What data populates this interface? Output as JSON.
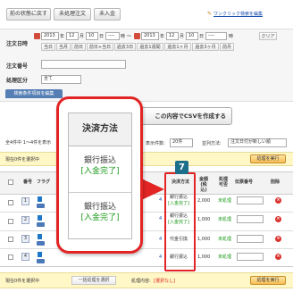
{
  "toolbar": {
    "back_label": "前の状態に戻す",
    "unprocessed_label": "未処理注文",
    "received_label": "未入金",
    "oneclick_label": "ワンクリック検索を編集"
  },
  "search": {
    "order_date_label": "注文日時",
    "year_from": "2013",
    "year_unit": "年",
    "month_from": "12",
    "month_unit": "月",
    "day_from": "10",
    "day_unit": "日",
    "hour_from": "----",
    "hour_unit": "時",
    "to_sep": "〜",
    "year_to": "2013",
    "month_to": "12",
    "day_to": "10",
    "hour_to": "----",
    "clear_label": "クリア",
    "quick_today": "当日",
    "quick_month": "当月",
    "quick_prev": "前日",
    "quick_prev_today": "前日+当日",
    "quick_3days": "過去3日",
    "quick_1week": "過去1週間",
    "quick_1month": "過去1ヶ月",
    "quick_3months": "過去3ヶ月",
    "quick_next": "前月",
    "order_no_label": "注文番号",
    "status_label": "処理区分",
    "status_value": "全て",
    "edit_conditions_label": "検索条件項目を編集"
  },
  "csv": {
    "create_label": "この内容でCSVを作成する"
  },
  "list": {
    "count_text": "全4件中 1〜4件を表示",
    "per_page_label": "表示件数:",
    "per_page_value": "20件",
    "sort_label": "並列方法:",
    "sort_value": "注文日付が新しい順"
  },
  "bulk_top": {
    "selected_text": "現在0件を選択中",
    "execute_label": "処理を実行"
  },
  "table": {
    "headers": {
      "check": "",
      "number": "番号",
      "flag": "フラグ",
      "payment": "決済方法",
      "amount": "金額(税込)",
      "process": "処理可否",
      "tracking": "伝票番号",
      "delete": "削除"
    },
    "rows": [
      {
        "number": "1",
        "pay_line1": "銀行振込",
        "pay_line2": "[入金完了]",
        "amount": "2,000",
        "process": "未処理"
      },
      {
        "number": "2",
        "pay_line1": "銀行振込",
        "pay_line2": "[入金完了]",
        "amount": "1,000",
        "process": "未処理"
      },
      {
        "number": "3",
        "pay_line1": "代金引換",
        "pay_line2": "",
        "amount": "1,000",
        "process": "未処理"
      },
      {
        "number": "4",
        "pay_line1": "銀行振込",
        "pay_line2": "",
        "amount": "1,000",
        "process": "未処理"
      }
    ],
    "partial_numbers": [
      "4",
      "4",
      "4",
      "4"
    ]
  },
  "callout": {
    "header": "決済方法",
    "rows": [
      {
        "line1": "銀行振込",
        "line2": "[入金完了]"
      },
      {
        "line1": "銀行振込",
        "line2": "[入金完了]"
      }
    ]
  },
  "step_badge": "7",
  "bulk_bottom": {
    "selected_text": "現在0件を選択中",
    "select_all_label": "一括処理を選択",
    "process_text": "処理内容:",
    "process_value": "[選択なし]",
    "execute_label": "処理を実行"
  },
  "colors": {
    "accent_red": "#e22424",
    "badge_teal": "#1c6f8a",
    "paid_green": "#1c9a1c"
  }
}
